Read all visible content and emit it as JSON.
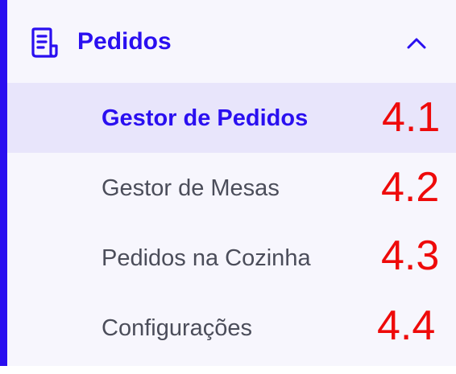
{
  "section": {
    "title": "Pedidos",
    "icon": "document-list-icon",
    "toggle_icon": "chevron-up-icon"
  },
  "items": [
    {
      "label": "Gestor de Pedidos",
      "number": "4.1",
      "active": true
    },
    {
      "label": "Gestor de Mesas",
      "number": "4.2",
      "active": false
    },
    {
      "label": "Pedidos na Cozinha",
      "number": "4.3",
      "active": false
    },
    {
      "label": "Configurações",
      "number": "4.4",
      "active": false
    }
  ],
  "colors": {
    "accent": "#2a0ff0",
    "active_bg": "#e8e5fb",
    "panel_bg": "#f7f6fd",
    "text": "#4b4d5a",
    "annotation": "#ee0a0a"
  }
}
